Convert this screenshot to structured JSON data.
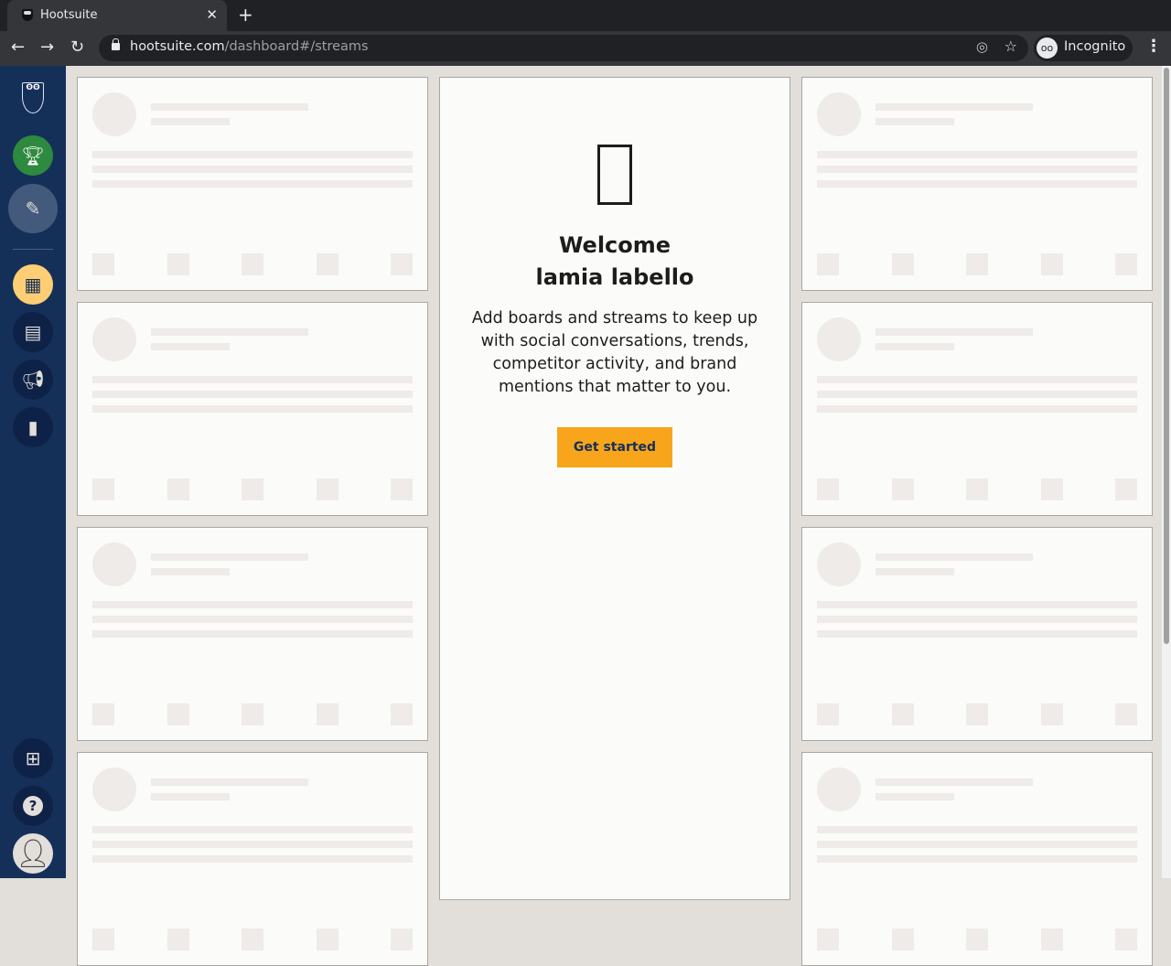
{
  "browser": {
    "tab_title": "Hootsuite",
    "url_host": "hootsuite.com",
    "url_path": "/dashboard#/streams",
    "profile": "Incognito"
  },
  "sidebar": {
    "items": [
      "streams",
      "planner",
      "advertise",
      "analytics"
    ],
    "logo": "Hootsuite"
  },
  "welcome": {
    "icon": "?",
    "heading_line1": "Welcome",
    "heading_line2": "lamia labello",
    "description": "Add boards and streams to keep up with social conversations, trends, competitor activity, and brand mentions that matter to you.",
    "button": "Get started"
  },
  "colors": {
    "sidebar": "#143059",
    "accent": "#f8a51b",
    "active": "#ffce74",
    "trophy": "#2d8a3e"
  }
}
